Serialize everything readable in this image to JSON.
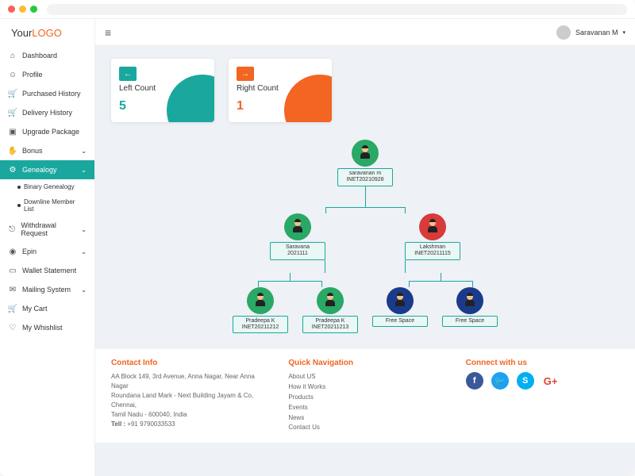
{
  "logo": {
    "part1": "Your",
    "part2": "LOGO"
  },
  "user": {
    "name": "Saravanan M"
  },
  "sidebar": [
    {
      "label": "Dashboard",
      "icon": "⌂"
    },
    {
      "label": "Profile",
      "icon": "☺"
    },
    {
      "label": "Purchased History",
      "icon": "🛒"
    },
    {
      "label": "Delivery History",
      "icon": "🛒"
    },
    {
      "label": "Upgrade Package",
      "icon": "▣"
    },
    {
      "label": "Bonus",
      "icon": "✋",
      "expandable": true
    },
    {
      "label": "Genealogy",
      "icon": "⚙",
      "active": true,
      "expandable": true,
      "children": [
        {
          "label": "Binary Genealogy"
        },
        {
          "label": "Downline Member List"
        }
      ]
    },
    {
      "label": "Withdrawal Request",
      "icon": "⎋",
      "expandable": true
    },
    {
      "label": "Epin",
      "icon": "◉",
      "expandable": true
    },
    {
      "label": "Wallet Statement",
      "icon": "▭"
    },
    {
      "label": "Mailing System",
      "icon": "✉",
      "expandable": true
    },
    {
      "label": "My Cart",
      "icon": "🛒"
    },
    {
      "label": "My Whishlist",
      "icon": "♡"
    }
  ],
  "cards": {
    "left": {
      "label": "Left Count",
      "value": "5",
      "arrow": "←"
    },
    "right": {
      "label": "Right Count",
      "value": "1",
      "arrow": "→"
    }
  },
  "tree": {
    "root": {
      "name": "saravanan m",
      "id": "INET20210928",
      "color": "green"
    },
    "l1": [
      {
        "name": "Saravana",
        "id": "2021111",
        "color": "green"
      },
      {
        "name": "Lakshman",
        "id": "INET20211115",
        "color": "red"
      }
    ],
    "l2": [
      {
        "name": "Pradeepa K",
        "id": "INET20211212",
        "color": "green"
      },
      {
        "name": "Pradeepa K",
        "id": "INET20211213",
        "color": "green"
      },
      {
        "name": "Free Space",
        "id": "",
        "color": "blue"
      },
      {
        "name": "Free Space",
        "id": "",
        "color": "blue"
      }
    ]
  },
  "footer": {
    "contact": {
      "title": "Contact Info",
      "line1": "AA Block 149, 3rd Avenue, Anna Nagar, Near Anna Nagar",
      "line2": "Roundana Land Mark - Next Building Jayam & Co, Chennai,",
      "line3": "Tamil Nadu - 600040, India",
      "tel_label": "Tell :",
      "tel": "+91 9790033533"
    },
    "nav": {
      "title": "Quick Navigation",
      "links": [
        "About US",
        "How it Works",
        "Products",
        "Events",
        "News",
        "Contact Us"
      ]
    },
    "connect": {
      "title": "Connect with us"
    }
  }
}
